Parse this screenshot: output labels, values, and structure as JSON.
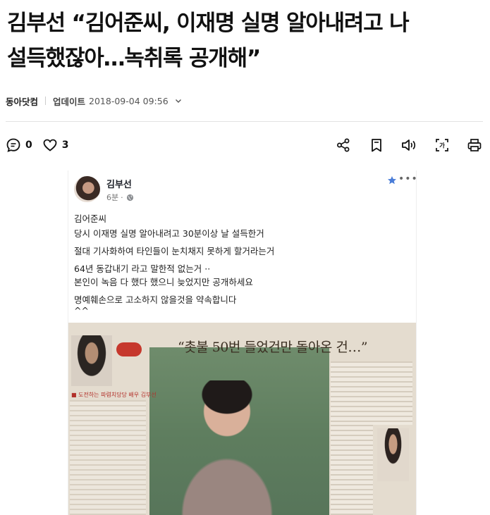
{
  "article": {
    "headline_line1": "김부선 “김어준씨, 이재명 실명 알아내려고 나",
    "headline_line2": "설득했잖아…녹취록 공개해”",
    "source": "동아닷컴",
    "updated_label": "업데이트",
    "updated_at": "2018-09-04 09:56"
  },
  "actions": {
    "comment_count": "0",
    "like_count": "3",
    "right_icons": [
      "share-icon",
      "bookmark-icon",
      "speaker-icon",
      "translate-icon",
      "print-icon"
    ]
  },
  "post": {
    "author": "김부선",
    "time": "6분",
    "time_separator": "·",
    "lines": [
      "김어준씨",
      "당시 이재명 실명 알아내려고 30분이상 날 설득한거",
      "절대 기사화하여 타인들이 눈치채지 못하게 할거라는거",
      "64년 동갑내기 라고 말한적 없는거 ··",
      "본인이 녹음 다 했다 했으니 늦었지만 공개하세요",
      "명예훼손으로 고소하지 않을것을 약속합니다",
      "^^"
    ],
    "clipping_headline": "“촛불 50번 들었건만 돌아온 건…”",
    "clipping_tag": "■ 도전하는 파렴치당당 배우 김부선"
  }
}
